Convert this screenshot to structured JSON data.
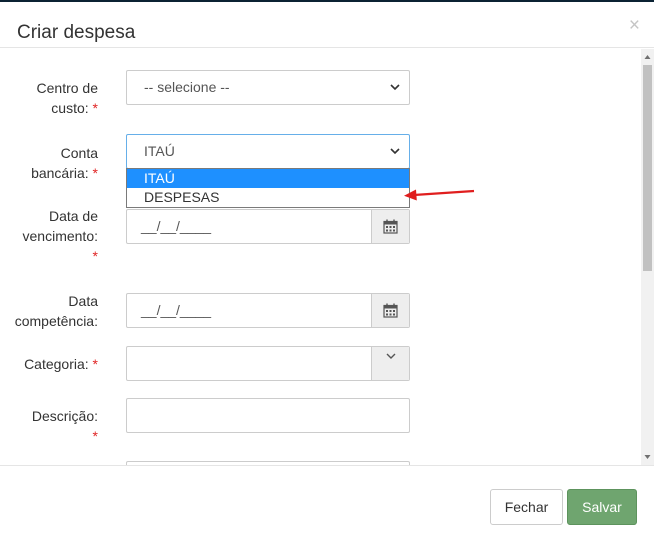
{
  "dialog": {
    "title": "Criar despesa",
    "close_symbol": "×"
  },
  "form": {
    "centro_custo": {
      "label_line1": "Centro de",
      "label_line2": "custo:",
      "required_mark": "*",
      "value": "-- selecione --"
    },
    "conta_bancaria": {
      "label_line1": "Conta",
      "label_line2": "bancária:",
      "required_mark": "*",
      "value": "ITAÚ",
      "options": [
        "ITAÚ",
        "DESPESAS"
      ],
      "highlighted_option": "ITAÚ"
    },
    "data_vencimento": {
      "label_line1": "Data de",
      "label_line2": "vencimento:",
      "required_mark": "*",
      "placeholder": "__/__/____"
    },
    "data_competencia": {
      "label_line1": "Data",
      "label_line2": "competência:",
      "placeholder": "__/__/____"
    },
    "categoria": {
      "label": "Categoria:",
      "required_mark": "*",
      "value": ""
    },
    "descricao": {
      "label": "Descrição:",
      "required_mark": "*",
      "value": ""
    }
  },
  "footer": {
    "close_label": "Fechar",
    "save_label": "Salvar"
  },
  "colors": {
    "save_button": "#6fa56f",
    "highlight": "#1e90ff",
    "required": "#e02424",
    "annotation_arrow": "#e01e1e"
  },
  "icons": [
    "close-icon",
    "chevron-down-icon",
    "calendar-icon",
    "red-arrow-annotation"
  ]
}
